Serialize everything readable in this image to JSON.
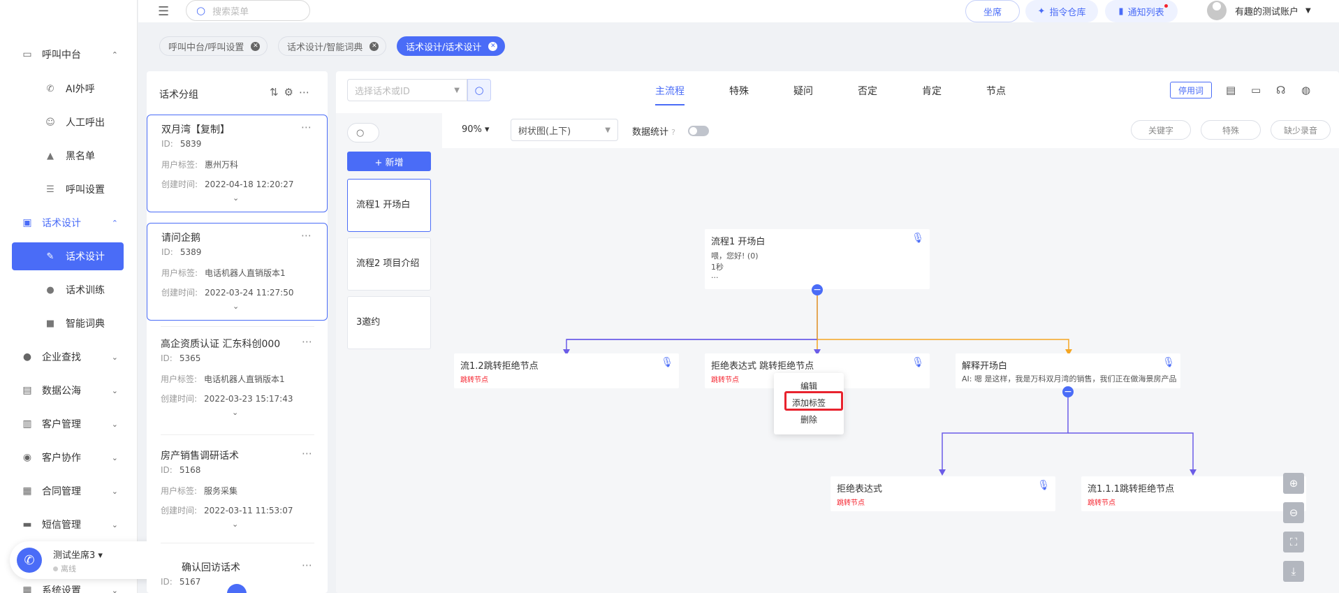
{
  "sidebar": {
    "groups": [
      {
        "label": "呼叫中台",
        "icon": "monitor-icon"
      },
      {
        "label": "话术设计",
        "icon": "book-icon"
      },
      {
        "label": "企业查找",
        "icon": "bulb-icon"
      },
      {
        "label": "数据公海",
        "icon": "chart-icon"
      },
      {
        "label": "客户管理",
        "icon": "customer-icon"
      },
      {
        "label": "客户协作",
        "icon": "collab-icon"
      },
      {
        "label": "合同管理",
        "icon": "clipboard-icon"
      },
      {
        "label": "短信管理",
        "icon": "message-icon"
      },
      {
        "label": "系统设置",
        "icon": "settings-icon"
      }
    ],
    "call_items": [
      {
        "label": "AI外呼",
        "icon": "phone-icon"
      },
      {
        "label": "人工呼出",
        "icon": "person-icon"
      },
      {
        "label": "黑名单",
        "icon": "warning-icon"
      },
      {
        "label": "呼叫设置",
        "icon": "sliders-icon"
      }
    ],
    "script_items": [
      {
        "label": "话术设计",
        "icon": "pen-icon"
      },
      {
        "label": "话术训练",
        "icon": "chat-icon"
      },
      {
        "label": "智能词典",
        "icon": "dictionary-icon"
      }
    ],
    "agent": {
      "name": "测试坐席3",
      "status": "离线"
    }
  },
  "header": {
    "search_placeholder": "搜索菜单",
    "seat_btn": "坐席",
    "command_btn": "指令仓库",
    "notice_btn": "通知列表",
    "username": "有趣的测试账户"
  },
  "tabs": [
    {
      "label": "呼叫中台/呼叫设置"
    },
    {
      "label": "话术设计/智能词典"
    },
    {
      "label": "话术设计/话术设计"
    }
  ],
  "group_panel": {
    "title": "话术分组",
    "cards": [
      {
        "title": "双月湾【复制】",
        "id_label": "ID:",
        "id": "5839",
        "tag_label": "用户标签:",
        "tag": "惠州万科",
        "time_label": "创建时间:",
        "time": "2022-04-18 12:20:27"
      },
      {
        "title": "请问企鹅",
        "id_label": "ID:",
        "id": "5389",
        "tag_label": "用户标签:",
        "tag": "电话机器人直销版本1",
        "time_label": "创建时间:",
        "time": "2022-03-24 11:27:50"
      },
      {
        "title": "高企资质认证 汇东科创000",
        "id_label": "ID:",
        "id": "5365",
        "tag_label": "用户标签:",
        "tag": "电话机器人直销版本1",
        "time_label": "创建时间:",
        "time": "2022-03-23 15:17:43"
      },
      {
        "title": "房产销售调研话术",
        "id_label": "ID:",
        "id": "5168",
        "tag_label": "用户标签:",
        "tag": "服务采集",
        "time_label": "创建时间:",
        "time": "2022-03-11 11:53:07"
      },
      {
        "title": "确认回访话术",
        "id_label": "ID:",
        "id": "5167"
      }
    ]
  },
  "main": {
    "script_select_placeholder": "选择话术或ID",
    "flow_tabs": [
      "主流程",
      "特殊",
      "疑问",
      "否定",
      "肯定",
      "节点"
    ],
    "disable_btn": "停用词",
    "add_btn": "+ 新增",
    "flows": [
      "流程1 开场白",
      "流程2 项目介绍",
      "3邀约"
    ],
    "zoom": "90%",
    "layout_select": "树状图(上下)",
    "data_stat_label": "数据统计",
    "pills": [
      "关键字",
      "特殊",
      "缺少录音"
    ]
  },
  "canvas": {
    "root": {
      "title": "流程1 开场白",
      "line1": "喂，您好! (0)",
      "line2": "1秒",
      "line3": "..."
    },
    "nodes": [
      {
        "title": "流1.2跳转拒绝节点",
        "tag": "跳转节点"
      },
      {
        "title": "拒绝表达式 跳转拒绝节点",
        "tag": "跳转节点"
      },
      {
        "title": "解释开场白",
        "line": "AI: 嗯 是这样，我是万科双月湾的销售，我们正在做海景房产品"
      },
      {
        "title": "拒绝表达式",
        "tag": "跳转节点"
      },
      {
        "title": "流1.1.1跳转拒绝节点",
        "tag": "跳转节点"
      }
    ],
    "context_menu": [
      "编辑",
      "添加标签",
      "删除"
    ]
  },
  "colors": {
    "accent": "#4a6cf7",
    "orange": "#f5a623",
    "purple": "#6b5ce7",
    "danger": "#f5222d"
  }
}
